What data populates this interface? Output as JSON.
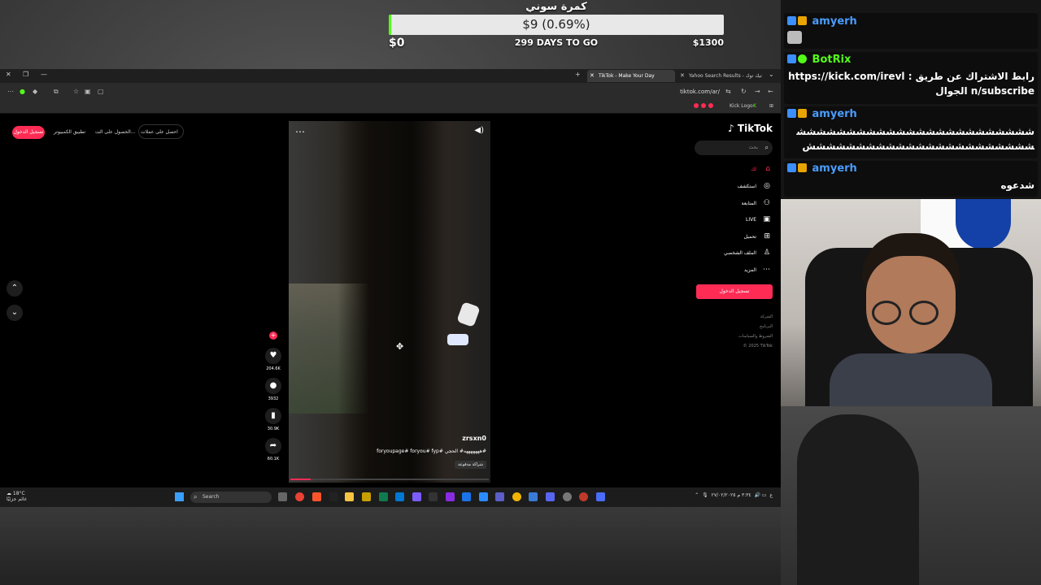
{
  "goal": {
    "title": "كمرة سوني",
    "amount": "$9 (0.69%)",
    "progress": 0.0069,
    "min": "$0",
    "days": "299 DAYS TO GO",
    "max": "$1300"
  },
  "browser": {
    "tabs": [
      {
        "label": "TikTok - Make Your Day",
        "active": true
      },
      {
        "label": "Yahoo Search Results - تيك توك",
        "active": false
      }
    ],
    "url": "tiktok.com/ar/",
    "bookmark": "Kick Logo"
  },
  "tiktok": {
    "top_login": "تسجيل الدخول",
    "top_link_1": "تطبيق الكمبيوتر",
    "top_link_2": "الحصول على الت...",
    "top_link_3": "احصل على عملات",
    "logo": "TikTok",
    "search_placeholder": "بحث",
    "nav": [
      {
        "label": "لك",
        "icon": "home-icon"
      },
      {
        "label": "استكشف",
        "icon": "compass-icon"
      },
      {
        "label": "المتابعة",
        "icon": "following-icon"
      },
      {
        "label": "LIVE",
        "icon": "live-icon"
      },
      {
        "label": "تحميل",
        "icon": "upload-icon"
      },
      {
        "label": "الملف الشخصي",
        "icon": "profile-icon"
      },
      {
        "label": "المزيد",
        "icon": "more-icon"
      }
    ],
    "side_login": "تسجيل الدخول",
    "footer": [
      "الشركة",
      "البرنامج",
      "الشروط والسياسات",
      "© 2025 TikTok"
    ],
    "video": {
      "username": "zrsxn0",
      "tags": "foryoupage# foryou# fyp# هههههههه# الحجي#",
      "sponsor": "شراكة مدفوعة"
    },
    "actions": {
      "likes": "204.6K",
      "comments": "3932",
      "saves": "30.9K",
      "shares": "60.1K"
    }
  },
  "taskbar": {
    "weather_temp": "18°C",
    "weather_desc": "غائم جزئيًا",
    "search": "Search",
    "time": "٣:٣٤ م",
    "date": "٢٧/٠٢/٢٠٢٥"
  },
  "chat": {
    "messages": [
      {
        "user": "amyerh",
        "user_color": "#4a9cff",
        "text": ""
      },
      {
        "user": "BotRix",
        "user_color": "#53fc18",
        "text": "رابط الاشتراك عن طريق : https://kick.com/irevln/subscribe الجوال"
      },
      {
        "user": "amyerh",
        "user_color": "#4a9cff",
        "text": "ششششششششششششششششششششششششششششششششششششششششششششششش"
      },
      {
        "user": "amyerh",
        "user_color": "#4a9cff",
        "text": "شدعوه"
      }
    ]
  },
  "colors": {
    "tiktok_accent": "#fe2c55",
    "kick_green": "#53fc18"
  }
}
